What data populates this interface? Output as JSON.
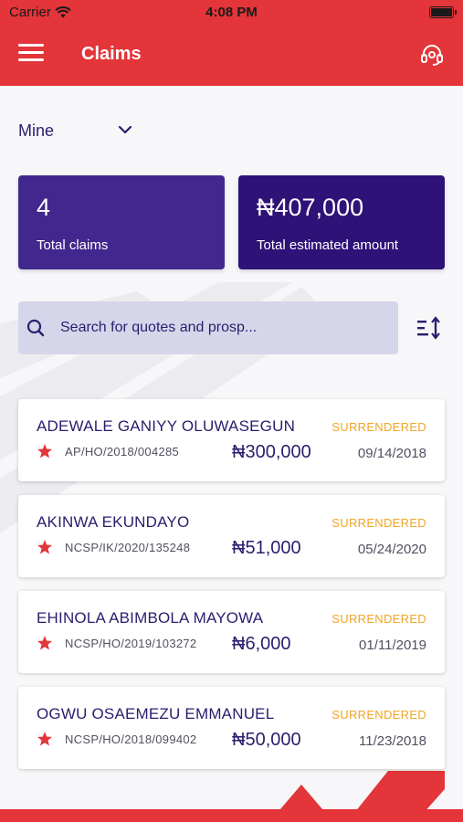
{
  "status_bar": {
    "carrier": "Carrier",
    "time": "4:08 PM"
  },
  "app_bar": {
    "title": "Claims"
  },
  "filter": {
    "selected": "Mine"
  },
  "stats": {
    "claims_value": "4",
    "claims_label": "Total claims",
    "amount_value": "₦407,000",
    "amount_label": "Total estimated amount"
  },
  "search": {
    "placeholder": "Search for quotes and prosp..."
  },
  "claims": [
    {
      "name": "ADEWALE GANIYY OLUWASEGUN",
      "status": "SURRENDERED",
      "ref": "AP/HO/2018/004285",
      "amount": "₦300,000",
      "date": "09/14/2018"
    },
    {
      "name": "AKINWA EKUNDAYO",
      "status": "SURRENDERED",
      "ref": "NCSP/IK/2020/135248",
      "amount": "₦51,000",
      "date": "05/24/2020"
    },
    {
      "name": "EHINOLA ABIMBOLA MAYOWA",
      "status": "SURRENDERED",
      "ref": "NCSP/HO/2019/103272",
      "amount": "₦6,000",
      "date": "01/11/2019"
    },
    {
      "name": "OGWU OSAEMEZU EMMANUEL",
      "status": "SURRENDERED",
      "ref": "NCSP/HO/2018/099402",
      "amount": "₦50,000",
      "date": "11/23/2018"
    }
  ],
  "colors": {
    "brand_red": "#e3353a",
    "primary_purple": "#2b1d6e",
    "status_orange": "#f0a524",
    "star_red": "#e3353a"
  }
}
